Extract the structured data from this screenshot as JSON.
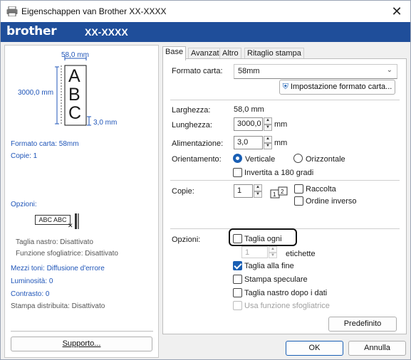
{
  "window": {
    "title": "Eigenschappen van Brother XX-XXXX",
    "close_glyph": "✕"
  },
  "brand": {
    "logo": "brother",
    "model": "XX-XXXX"
  },
  "preview": {
    "width_label": "58,0 mm",
    "length_label": "3000,0 mm",
    "margin_label": "3,0 mm",
    "letters": [
      "A",
      "B",
      "C"
    ]
  },
  "summary": {
    "paper": "Formato carta: 58mm",
    "copies": "Copie: 1",
    "options_label": "Opzioni:",
    "sample_text": "ABC ABC",
    "tape_cut": "Taglia nastro: Disattivato",
    "peeler": "Funzione sfogliatrice: Disattivato",
    "halftone": "Mezzi toni: Diffusione d'errore",
    "brightness": "Luminosità:   0",
    "contrast": "Contrasto:   0",
    "distributed": "Stampa distribuita: Disattivato",
    "support_button": "Supporto..."
  },
  "tabs": [
    "Base",
    "Avanzate",
    "Altro",
    "Ritaglio stampa"
  ],
  "basic": {
    "paper_size_label": "Formato carta:",
    "paper_size_value": "58mm",
    "paper_setup_button": "Impostazione formato carta...",
    "width_label": "Larghezza:",
    "width_value": "58,0 mm",
    "length_label": "Lunghezza:",
    "length_value": "3000,0",
    "length_unit": "mm",
    "feed_label": "Alimentazione:",
    "feed_value": "3,0",
    "feed_unit": "mm",
    "orientation_label": "Orientamento:",
    "portrait": "Verticale",
    "landscape": "Orizzontale",
    "rotate180": "Invertita a 180 gradi",
    "copies_label": "Copie:",
    "copies_value": "1",
    "collate": "Raccolta",
    "reverse": "Ordine inverso",
    "options_label": "Opzioni:",
    "cut_every": "Taglia ogni",
    "cut_every_value": "1",
    "labels_unit": "etichette",
    "cut_at_end": "Taglia alla fine",
    "mirror": "Stampa speculare",
    "cut_tape_after": "Taglia nastro dopo i dati",
    "use_peeler": "Usa funzione sfogliatrice",
    "default_button": "Predefinito"
  },
  "footer": {
    "ok": "OK",
    "cancel": "Annulla"
  },
  "colors": {
    "brand_bar": "#1f4e9a",
    "accent": "#1a5fb4",
    "summary_text": "#1f55b8"
  }
}
